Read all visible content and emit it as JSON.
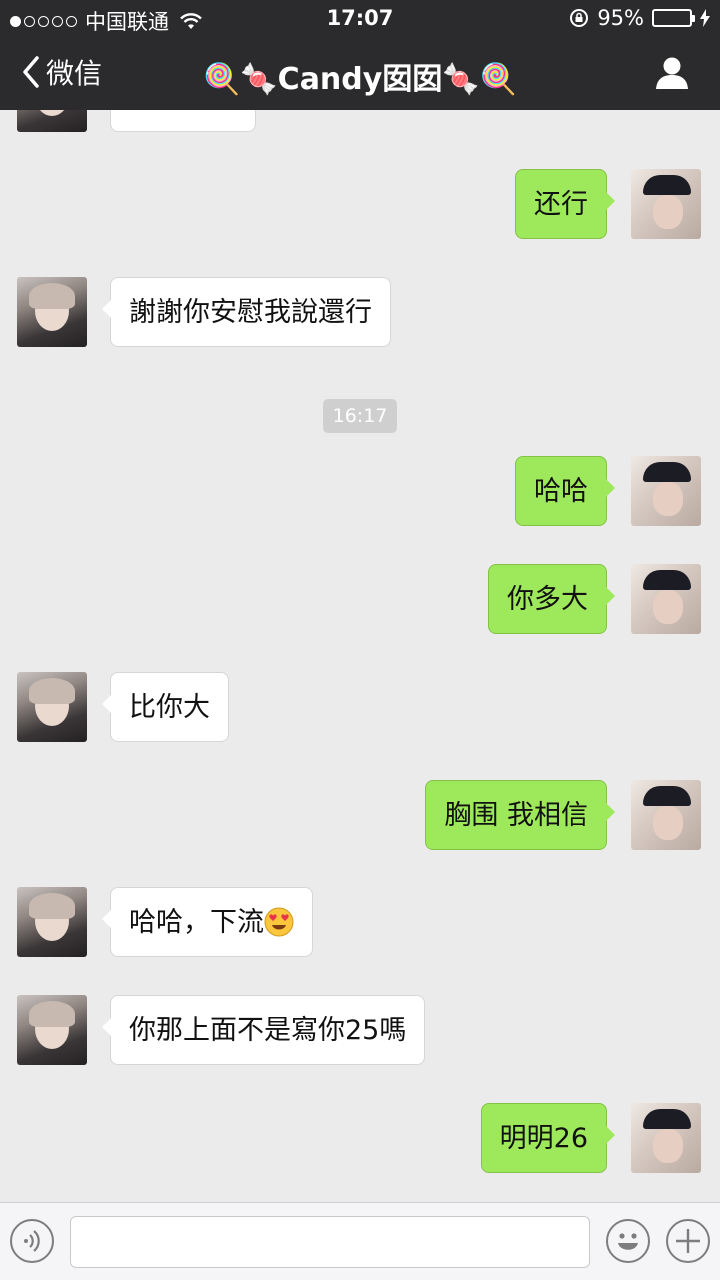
{
  "status_bar": {
    "carrier": "中国联通",
    "time": "17:07",
    "battery_percent": "95%",
    "battery_level": 0.95,
    "signal_bars_on": 1,
    "signal_bars_total": 5
  },
  "nav": {
    "back_label": "微信",
    "title": "🍭🍬Candy囡囡🍬🍭"
  },
  "messages": [
    {
      "side": "in",
      "text": ""
    },
    {
      "side": "out",
      "text": "还行"
    },
    {
      "side": "in",
      "text": "謝謝你安慰我說還行"
    },
    {
      "side": "out",
      "text": "哈哈"
    },
    {
      "side": "out",
      "text": "你多大"
    },
    {
      "side": "in",
      "text": "比你大"
    },
    {
      "side": "out",
      "text": "胸围 我相信"
    },
    {
      "side": "in",
      "text": "哈哈，下流",
      "emoji": "heart-eyes-emoji"
    },
    {
      "side": "in",
      "text": "你那上面不是寫你25嗎"
    },
    {
      "side": "out",
      "text": "明明26"
    }
  ],
  "timestamp": "16:17",
  "input": {
    "placeholder": "",
    "value": ""
  },
  "colors": {
    "header_bg": "#2b2b2d",
    "chat_bg": "#ebebeb",
    "outgoing_bubble": "#9ee85b",
    "incoming_bubble": "#ffffff",
    "battery_fill": "#7fe03d"
  },
  "icons": [
    "back-chevron-icon",
    "wifi-icon",
    "lock-rotation-icon",
    "battery-icon",
    "charging-icon",
    "person-icon",
    "voice-icon",
    "emoji-icon",
    "plus-icon"
  ]
}
